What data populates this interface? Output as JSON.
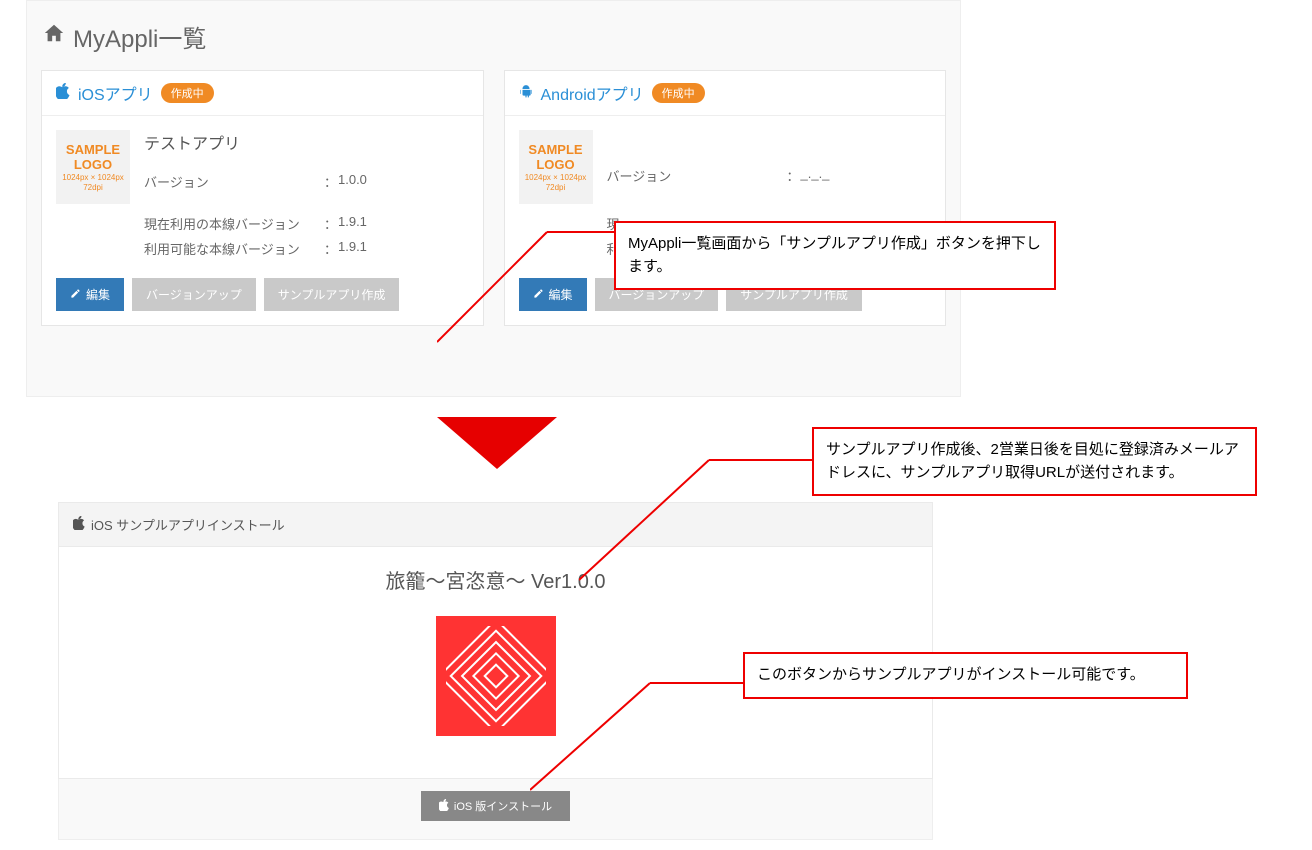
{
  "page_title": "MyAppli一覧",
  "ios_card": {
    "heading": "iOSアプリ",
    "badge": "作成中",
    "app_name": "テストアプリ",
    "version_label": "バージョン",
    "version_value": "1.0.0",
    "current_mainline_label": "現在利用の本線バージョン",
    "current_mainline_value": "1.9.1",
    "available_mainline_label": "利用可能な本線バージョン",
    "available_mainline_value": "1.9.1",
    "btn_edit": "編集",
    "btn_versionup": "バージョンアップ",
    "btn_sample": "サンプルアプリ作成",
    "logo_line1": "SAMPLE",
    "logo_line2": "LOGO",
    "logo_line3": "1024px × 1024px",
    "logo_line4": "72dpi"
  },
  "android_card": {
    "heading": "Androidアプリ",
    "badge": "作成中",
    "version_label": "バージョン",
    "version_value": "_._._",
    "current_mainline_prefix": "現",
    "available_mainline_prefix": "利",
    "btn_edit": "編集",
    "btn_versionup": "バージョンアップ",
    "btn_sample": "サンプルアプリ作成",
    "logo_line1": "SAMPLE",
    "logo_line2": "LOGO",
    "logo_line3": "1024px × 1024px",
    "logo_line4": "72dpi"
  },
  "install_panel": {
    "heading": "iOS サンプルアプリインストール",
    "title": "旅籠～宮恣意～ Ver1.0.0",
    "install_button": "iOS 版インストール"
  },
  "callouts": {
    "c1": "MyAppli一覧画面から「サンプルアプリ作成」ボタンを押下します。",
    "c2": "サンプルアプリ作成後、2営業日後を目処に登録済みメールアドレスに、サンプルアプリ取得URLが送付されます。",
    "c3": "このボタンからサンプルアプリがインストール可能です。"
  }
}
